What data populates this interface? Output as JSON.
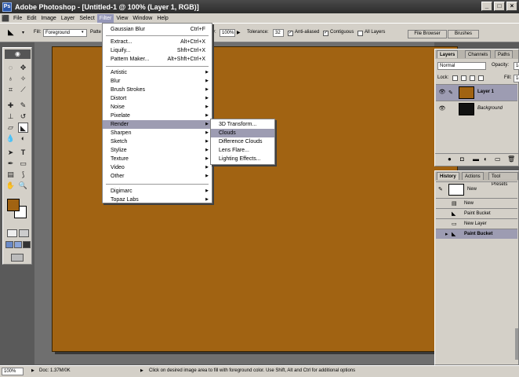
{
  "window": {
    "title": "Adobe Photoshop - [Untitled-1 @ 100% (Layer 1, RGB)]",
    "app_icon": "Ps",
    "min": "_",
    "max": "□",
    "close": "×"
  },
  "menubar": [
    "File",
    "Edit",
    "Image",
    "Layer",
    "Select",
    "Filter",
    "View",
    "Window",
    "Help"
  ],
  "options": {
    "fill_label": "Fill:",
    "fill_value": "Foreground",
    "pattern_label": "Patte",
    "opacity_label": "ity:",
    "opacity_value": "100%",
    "tolerance_label": "Tolerance:",
    "tolerance_value": "32",
    "anti_aliased": "Anti-aliased",
    "contiguous": "Contiguous",
    "all_layers": "All Layers",
    "file_browser": "File Browser",
    "brushes": "Brushes"
  },
  "filter_menu": {
    "top": [
      {
        "label": "Gaussian Blur",
        "shortcut": "Ctrl+F"
      }
    ],
    "group1": [
      {
        "label": "Extract...",
        "shortcut": "Alt+Ctrl+X"
      },
      {
        "label": "Liquify...",
        "shortcut": "Shft+Ctrl+X"
      },
      {
        "label": "Pattern Maker...",
        "shortcut": "Alt+Shft+Ctrl+X"
      }
    ],
    "group2": [
      "Artistic",
      "Blur",
      "Brush Strokes",
      "Distort",
      "Noise",
      "Pixelate",
      "Render",
      "Sharpen",
      "Sketch",
      "Stylize",
      "Texture",
      "Video",
      "Other"
    ],
    "group3": [
      "Digimarc",
      "Topaz Labs"
    ],
    "arrow": "▶"
  },
  "render_submenu": [
    "3D Transform...",
    "Clouds",
    "Difference Clouds",
    "Lens Flare...",
    "Lighting Effects..."
  ],
  "layers_panel": {
    "tabs": [
      "Layers",
      "Channels",
      "Paths"
    ],
    "blend_mode": "Normal",
    "opacity_label": "Opacity:",
    "opacity_value": "1(",
    "lock_label": "Lock:",
    "fill_label": "Fill:",
    "fill_value": "1(",
    "layers": [
      {
        "name": "Layer 1",
        "color": "#a16312"
      },
      {
        "name": "Background",
        "color": "#111111"
      }
    ]
  },
  "history_panel": {
    "tabs": [
      "History",
      "Actions",
      "Tool Presets"
    ],
    "snapshot": "New",
    "states": [
      "New",
      "Paint Bucket",
      "New Layer",
      "Paint Bucket"
    ]
  },
  "status": {
    "zoom": "100%",
    "doc": "Doc: 1.37M/0K",
    "hint": "Click on desired image area to fill with foreground color.  Use Shift, Alt and Ctrl for additional options",
    "arrow": "▶"
  },
  "colors": {
    "canvas": "#a16312",
    "foreground": "#a16312",
    "background": "#ffffff",
    "menu_highlight": "#9d9cb2"
  },
  "icons": {
    "paint-bucket": "◣",
    "eye": "👁",
    "brush": "✎"
  }
}
